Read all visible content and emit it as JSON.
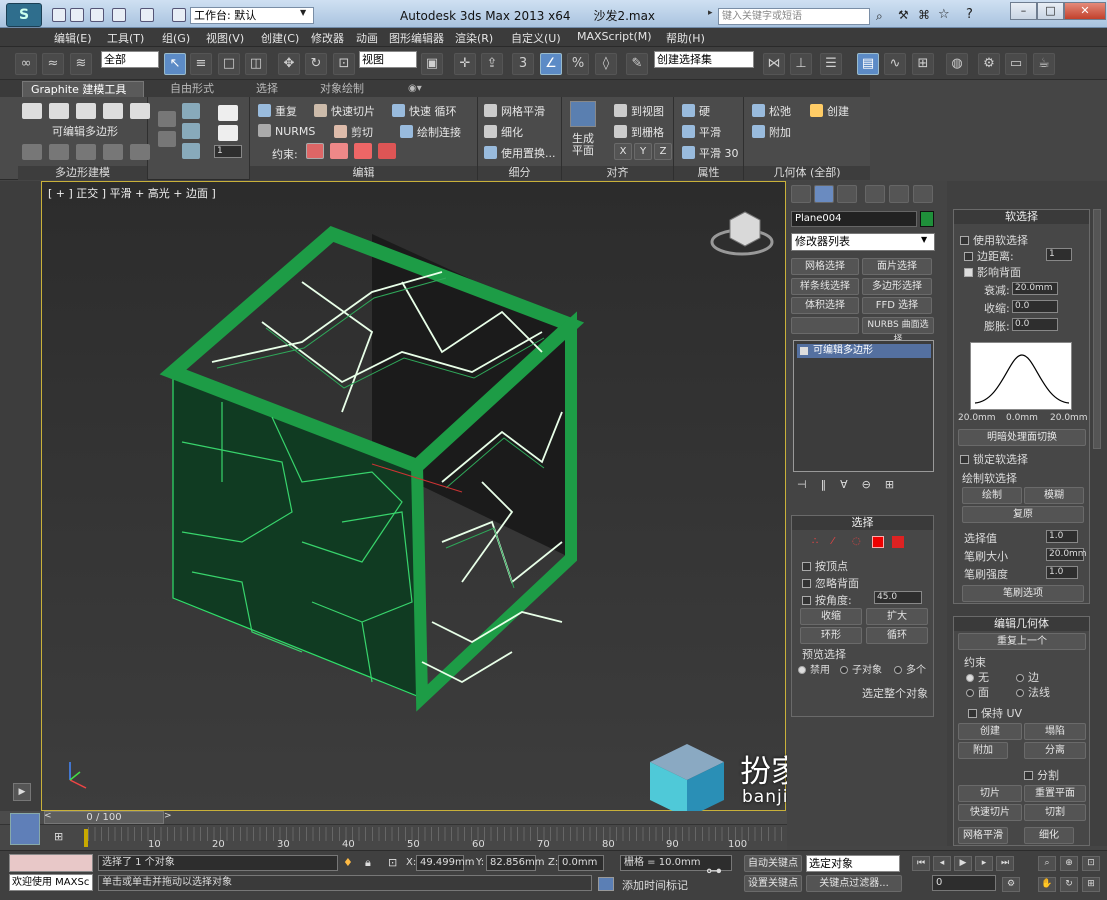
{
  "titlebar": {
    "workspace_label": "工作台: 默认",
    "app_title": "Autodesk 3ds Max  2013 x64",
    "file_name": "沙发2.max",
    "search_placeholder": "键入关键字或短语",
    "logo_letter": "S"
  },
  "menu": [
    "编辑(E)",
    "工具(T)",
    "组(G)",
    "视图(V)",
    "创建(C)",
    "修改器",
    "动画",
    "图形编辑器",
    "渲染(R)",
    "自定义(U)",
    "MAXScript(M)",
    "帮助(H)"
  ],
  "toolbar": {
    "selection_filter": "全部",
    "ref_coord": "视图",
    "named_selection": "创建选择集",
    "snap_label": "3"
  },
  "ribbon": {
    "tabs": [
      "Graphite 建模工具",
      "自由形式",
      "选择",
      "对象绘制"
    ],
    "editable_poly_label": "可编辑多边形",
    "group_poly_modeling": "多边形建模",
    "repeat_label": "重复",
    "quickslice_label": "快速切片",
    "quickloop_label": "快速 循环",
    "nurms_label": "NURMS",
    "cut_label": "剪切",
    "paintconnect_label": "绘制连接",
    "constraint_label": "约束:",
    "group_edit": "编辑",
    "meshsmooth_label": "网格平滑",
    "tessellate_label": "细化",
    "usedisplace_label": "使用置换...",
    "group_subdivision": "细分",
    "makeplanar_label": "生成 平面",
    "toview_label": "到视图",
    "togrid_label": "到栅格",
    "group_align": "对齐",
    "hard_label": "硬",
    "smooth_label": "平滑",
    "smooth30_label": "平滑 30",
    "group_properties": "属性",
    "relax_label": "松弛",
    "create_label": "创建",
    "attach_label": "附加",
    "group_geometry": "几何体 (全部)",
    "spinner_value": "1"
  },
  "viewport": {
    "label": "[ + ] 正交 ] 平滑 + 高光 + 边面 ]"
  },
  "command_panel": {
    "object_name": "Plane004",
    "color": "#1f8f3a",
    "modifier_list": "修改器列表",
    "buttons": [
      "网格选择",
      "面片选择",
      "样条线选择",
      "多边形选择",
      "体积选择",
      "FFD 选择",
      "",
      "NURBS 曲面选择"
    ],
    "stack_item": "可编辑多边形",
    "selection": {
      "title": "选择",
      "by_vertex": "按顶点",
      "ignore_backfacing": "忽略背面",
      "by_angle": "按角度:",
      "angle_value": "45.0",
      "shrink": "收缩",
      "grow": "扩大",
      "ring": "环形",
      "loop": "循环",
      "preview_title": "预览选择",
      "preview_off": "禁用",
      "preview_sub": "子对象",
      "preview_multi": "多个",
      "whole_object": "选定整个对象"
    }
  },
  "soft_selection": {
    "title": "软选择",
    "use_soft": "使用软选择",
    "edge_distance": "边距离:",
    "edge_distance_value": "1",
    "affect_backfacing": "影响背面",
    "falloff": "衰减:",
    "falloff_value": "20.0mm",
    "pinch": "收缩:",
    "pinch_value": "0.0",
    "bubble": "膨胀:",
    "bubble_value": "0.0",
    "curve_left": "20.0mm",
    "curve_mid": "0.0mm",
    "curve_right": "20.0mm",
    "shaded_face_toggle": "明暗处理面切换",
    "lock_soft": "锁定软选择",
    "paint_title": "绘制软选择",
    "paint": "绘制",
    "blur": "模糊",
    "revert": "复原",
    "sel_value": "选择值",
    "sel_value_v": "1.0",
    "brush_size": "笔刷大小",
    "brush_size_v": "20.0mm",
    "brush_strength": "笔刷强度",
    "brush_strength_v": "1.0",
    "brush_options": "笔刷选项"
  },
  "edit_geometry": {
    "title": "编辑几何体",
    "repeat_last": "重复上一个",
    "constraints": "约束",
    "c_none": "无",
    "c_edge": "边",
    "c_face": "面",
    "c_normal": "法线",
    "preserve_uv": "保持 UV",
    "create": "创建",
    "collapse": "塌陷",
    "attach": "附加",
    "detach": "分离",
    "split": "分割",
    "slice": "切片",
    "reset_plane": "重置平面",
    "quickslice": "快速切片",
    "cut": "切割",
    "meshsmooth": "网格平滑",
    "tessellate": "细化"
  },
  "timeline": {
    "frame_label": "0 / 100",
    "ticks": [
      "10",
      "20",
      "30",
      "40",
      "50",
      "60",
      "70",
      "80",
      "90",
      "100"
    ]
  },
  "status": {
    "welcome": "欢迎使用 MAXSc",
    "selected": "选择了 1 个对象",
    "prompt": "单击或单击并拖动以选择对象",
    "x_label": "X:",
    "x_value": "49.499mm",
    "y_label": "Y:",
    "y_value": "82.856mm",
    "z_label": "Z:",
    "z_value": "0.0mm",
    "grid": "栅格 = 10.0mm",
    "add_time_tag": "添加时间标记",
    "autokey": "自动关键点",
    "setkey": "设置关键点",
    "selected_obj": "选定对象",
    "key_filters": "关键点过滤器...",
    "frame_value": "0"
  },
  "watermark": {
    "title": "扮家家室内设计",
    "url": "banjiajia.com"
  }
}
